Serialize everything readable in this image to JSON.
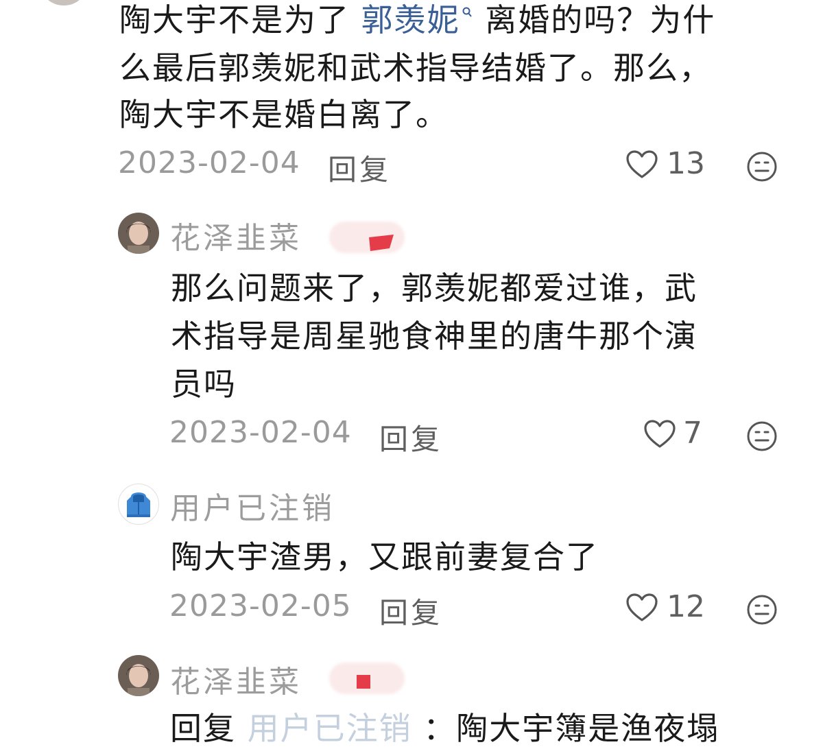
{
  "comments": [
    {
      "text_parts": [
        "陶大宇不是为了",
        "郭羡妮",
        "离婚的吗？为什"
      ],
      "lines_rest": [
        "么最后郭羡妮和武术指导结婚了。那么，",
        "陶大宇不是婚白离了。"
      ],
      "date": "2023-02-04",
      "reply_label": "回复",
      "likes": "13"
    },
    {
      "user": "花泽韭菜",
      "lines": [
        "那么问题来了，郭羡妮都爱过谁，武",
        "术指导是周星驰食神里的唐牛那个演",
        "员吗"
      ],
      "date": "2023-02-04",
      "reply_label": "回复",
      "likes": "7"
    },
    {
      "user": "用户已注销",
      "lines": [
        "陶大宇渣男，又跟前妻复合了"
      ],
      "date": "2023-02-05",
      "reply_label": "回复",
      "likes": "12"
    },
    {
      "user": "花泽韭菜",
      "partial_text": [
        "回复",
        "用户已注销",
        "：陶大宇簿是渔夜塌"
      ]
    }
  ],
  "icons": {
    "like": "heart-outline-icon",
    "reaction": "neutral-face-icon",
    "mention_search": "search-icon"
  },
  "colors": {
    "mention": "#3a5f95",
    "badge_red": "#e43c49",
    "muted_text": "#9c9c9c"
  }
}
